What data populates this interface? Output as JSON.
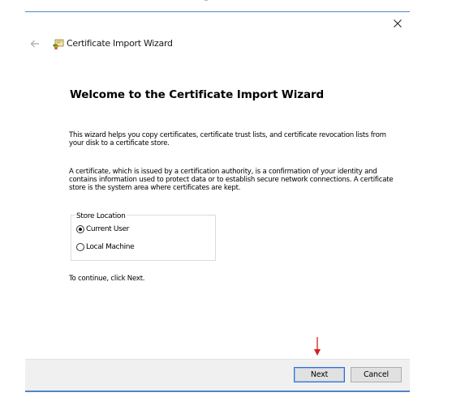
{
  "window": {
    "title": "Certificate Import Wizard",
    "close_icon": "close-icon",
    "back_icon": "back-arrow-icon",
    "app_icon": "certificate-icon"
  },
  "main": {
    "heading": "Welcome to the Certificate Import Wizard",
    "paragraph1": "This wizard helps you copy certificates, certificate trust lists, and certificate revocation lists from your disk to a certificate store.",
    "paragraph2": "A certificate, which is issued by a certification authority, is a confirmation of your identity and contains information used to protect data or to establish secure network connections. A certificate store is the system area where certificates are kept.",
    "store_location": {
      "legend": "Store Location",
      "options": [
        {
          "label": "Current User",
          "selected": true
        },
        {
          "label": "Local Machine",
          "selected": false
        }
      ]
    },
    "continue_text": "To continue, click Next."
  },
  "footer": {
    "next_label": "Next",
    "cancel_label": "Cancel"
  },
  "colors": {
    "accent_blue": "#4f86c6",
    "annotation_red": "#d42020",
    "footer_bg": "#f0f0f0"
  }
}
